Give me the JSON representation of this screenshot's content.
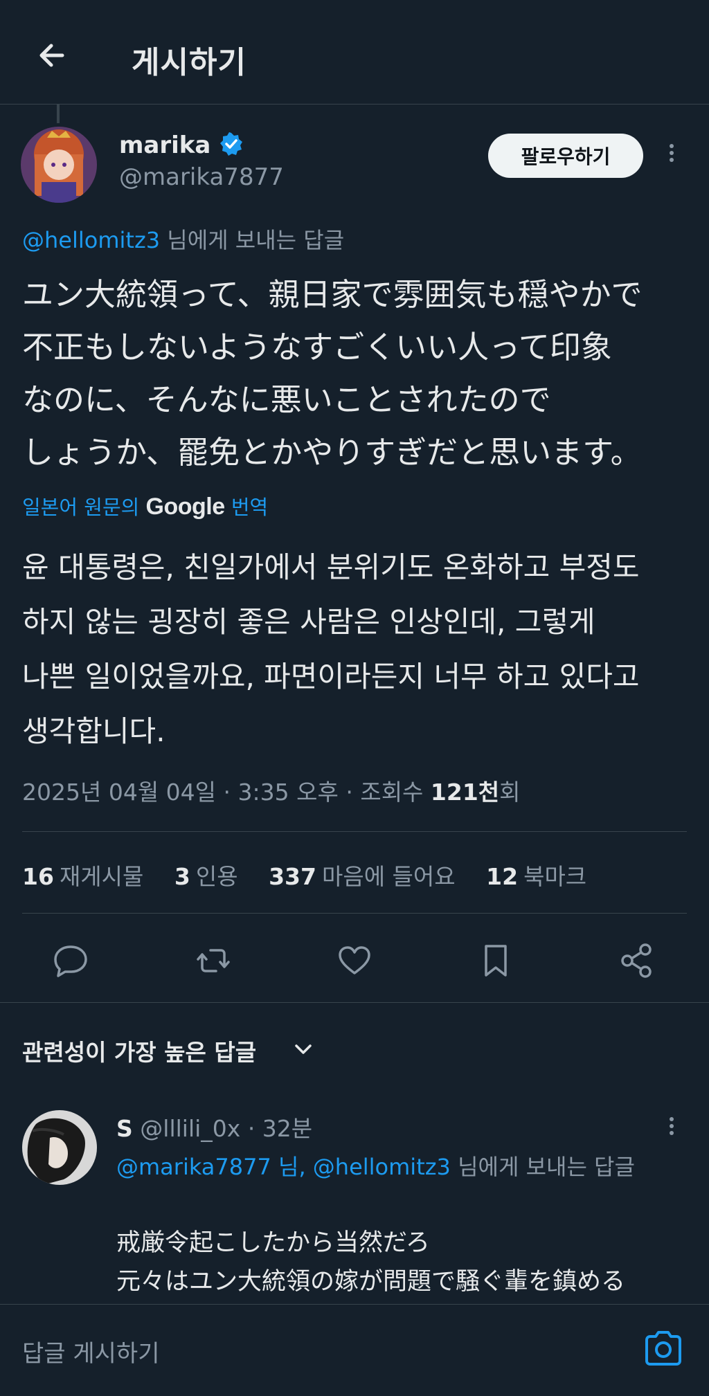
{
  "header": {
    "title": "게시하기"
  },
  "post": {
    "author_name": "marika",
    "handle": "@marika7877",
    "follow_label": "팔로우하기",
    "reply_to_handle": "@hellomitz3",
    "reply_to_suffix": " 님에게 보내는 답글",
    "text_jp": "ユン大統領って、親日家で雰囲気も穏やかで\n不正もしないようなすごくいい人って印象\nなのに、そんなに悪いことされたので\nしょうか、罷免とかやりすぎだと思います。",
    "translate_prefix": "일본어 원문의 ",
    "translate_google": "Google",
    "translate_suffix": " 번역",
    "text_ko": "윤 대통령은, 친일가에서 분위기도 온화하고 부정도\n하지 않는 굉장히 좋은 사람은 인상인데, 그렇게\n나쁜 일이었을까요, 파면이라든지 너무 하고 있다고\n생각합니다.",
    "meta": {
      "date": "2025년 04월 04일",
      "sep": " · ",
      "time": "3:35 오후",
      "views_label": "조회수 ",
      "views": "121천",
      "views_unit": "회"
    },
    "stats": {
      "reposts": "16",
      "reposts_label": "재게시물",
      "quotes": "3",
      "quotes_label": "인용",
      "likes": "337",
      "likes_label": "마음에 들어요",
      "bookmarks": "12",
      "bookmarks_label": "북마크"
    }
  },
  "replies_section": {
    "sort_label": "관련성이 가장 높은 답글"
  },
  "reply": {
    "name": "S",
    "handle": "@lllili_0x",
    "time": "· 32분",
    "to_handles": "@marika7877 님, @hellomitz3",
    "to_suffix": " 님에게 보내는 답글",
    "text": "戒厳令起こしたから当然だろ\n元々はユン大統領の嫁が問題で騒ぐ輩を鎮める"
  },
  "compose": {
    "placeholder": "답글 게시하기"
  },
  "colors": {
    "background": "#15202b",
    "accent": "#1d9bf0",
    "text": "#e7e9ea",
    "muted": "#8b98a5",
    "divider": "#38444d"
  }
}
